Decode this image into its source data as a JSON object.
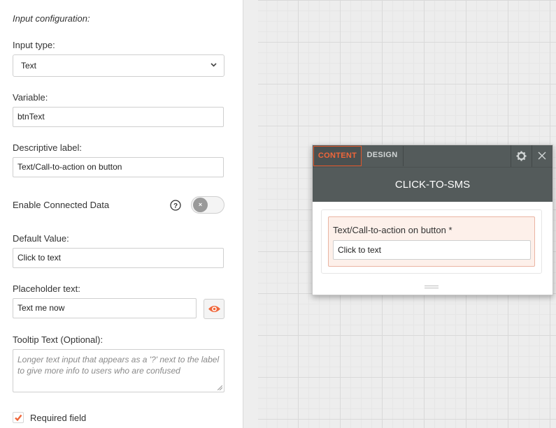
{
  "config": {
    "section_title": "Input configuration:",
    "input_type": {
      "label": "Input type:",
      "value": "Text"
    },
    "variable": {
      "label": "Variable:",
      "value": "btnText"
    },
    "descriptive_label": {
      "label": "Descriptive label:",
      "value": "Text/Call-to-action on button"
    },
    "connected_data": {
      "label": "Enable Connected Data",
      "enabled": false,
      "help_symbol": "?",
      "toggle_symbol": "×"
    },
    "default_value": {
      "label": "Default Value:",
      "value": "Click to text"
    },
    "placeholder": {
      "label": "Placeholder text:",
      "value": "Text me now"
    },
    "tooltip": {
      "label": "Tooltip Text (Optional):",
      "placeholder": "Longer text input that appears as a '?' next to the label to give more info to users who are confused"
    },
    "required": {
      "label": "Required field",
      "checked": true
    }
  },
  "widget": {
    "tabs": [
      "CONTENT",
      "DESIGN"
    ],
    "active_tab": "CONTENT",
    "title": "CLICK-TO-SMS",
    "field_label": "Text/Call-to-action on button *",
    "field_value": "Click to text",
    "toolbar_icons": [
      "gear-icon",
      "close-icon"
    ]
  },
  "colors": {
    "accent": "#f0663a",
    "widget_header": "#545b5b",
    "field_highlight_bg": "#fdf0ea",
    "field_highlight_border": "#eab4a2"
  }
}
